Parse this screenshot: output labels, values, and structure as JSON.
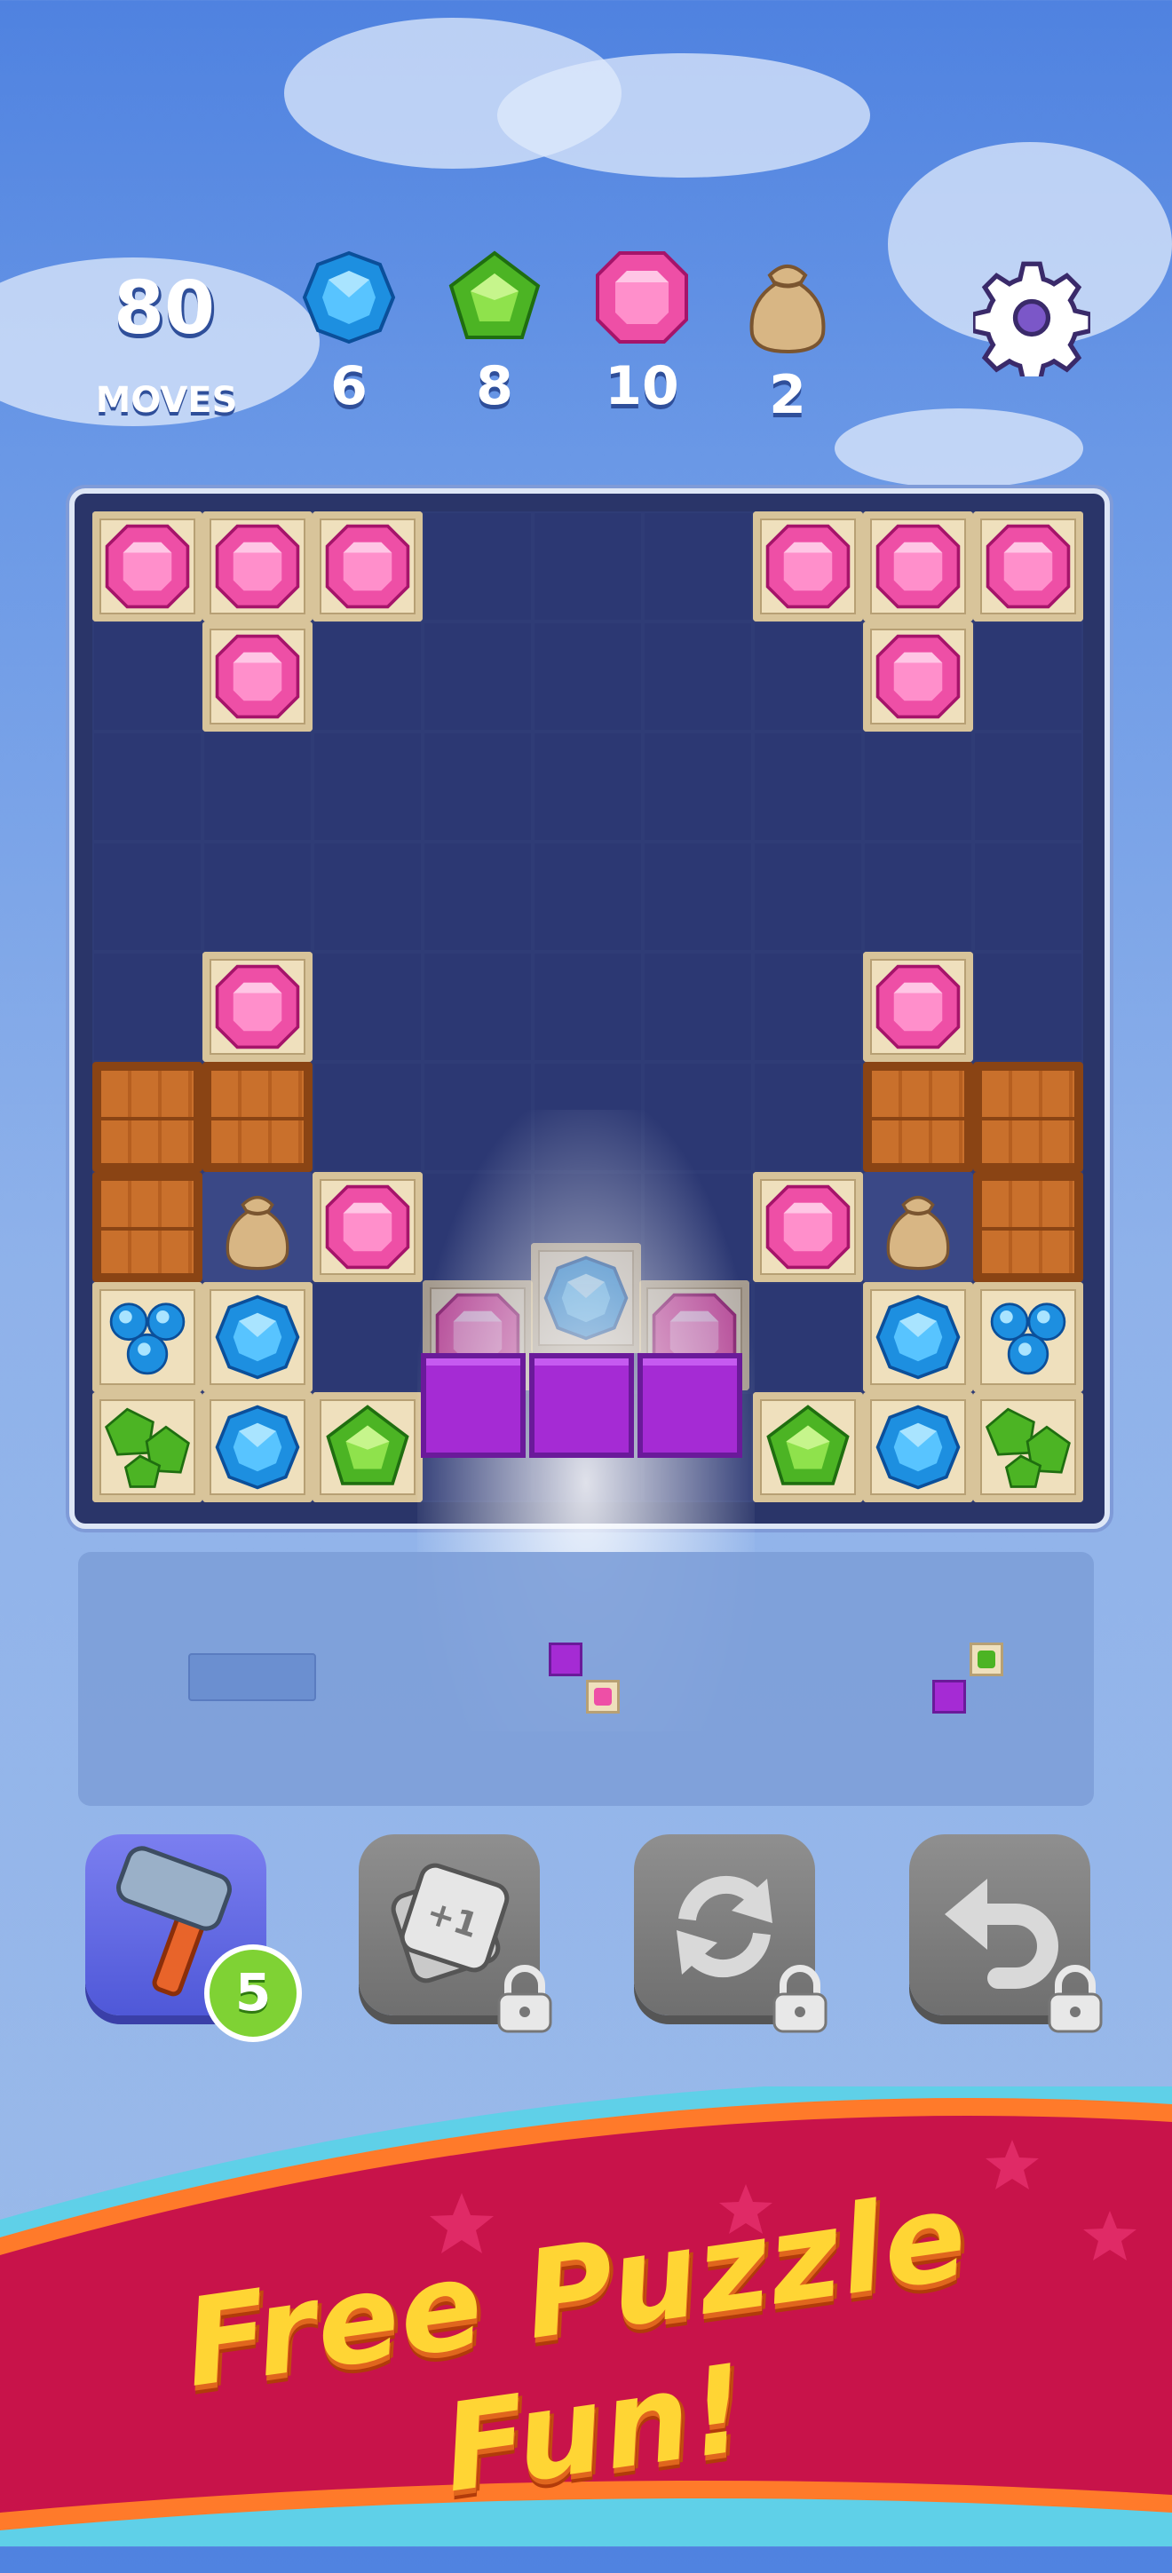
{
  "hud": {
    "moves_count": "80",
    "moves_label": "MOVES",
    "goals": [
      {
        "icon": "blue-gem-icon",
        "count": "6"
      },
      {
        "icon": "green-gem-icon",
        "count": "8"
      },
      {
        "icon": "pink-gem-icon",
        "count": "10"
      },
      {
        "icon": "sack-icon",
        "count": "2"
      }
    ],
    "settings_icon": "gear-icon"
  },
  "tools": [
    {
      "name": "hammer",
      "icon": "hammer-icon",
      "count": "5",
      "locked": false
    },
    {
      "name": "plus-one",
      "icon": "plus-one-icon",
      "label": "+1",
      "locked": true
    },
    {
      "name": "refresh",
      "icon": "refresh-icon",
      "locked": true
    },
    {
      "name": "undo",
      "icon": "undo-icon",
      "locked": true
    }
  ],
  "banner": {
    "text": "Free Puzzle Fun!"
  },
  "colors": {
    "pink_gem": "#ee4fa6",
    "blue_gem": "#1d8fe0",
    "green_gem": "#4cb424",
    "purple_block": "#a52bd4",
    "banner_red": "#c8134a",
    "banner_text": "#ffd534"
  }
}
